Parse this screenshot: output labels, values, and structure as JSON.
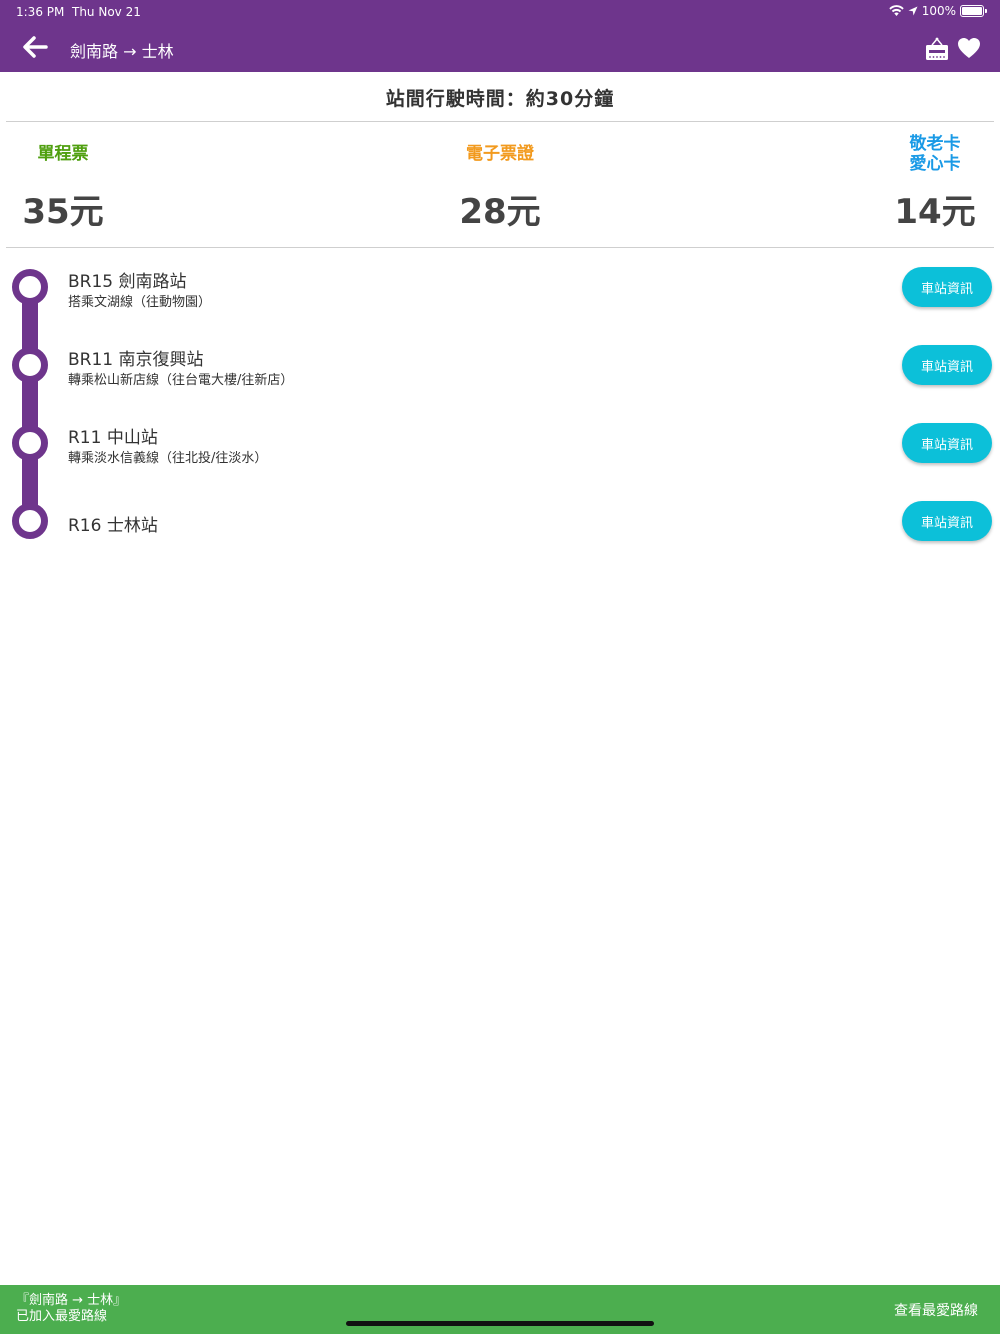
{
  "status_bar": {
    "time": "1:36 PM",
    "date": "Thu Nov 21",
    "battery": "100%",
    "battery_level": 1.0
  },
  "nav": {
    "title": "劍南路 → 士林",
    "back_icon": "back-arrow-icon",
    "hotel_icon": "hotel-sign-icon",
    "favorite_icon": "heart-icon"
  },
  "travel_time": "站間行駛時間：約30分鐘",
  "fares": [
    {
      "label": "單程票",
      "value": "35元",
      "color": "#4f9f0f"
    },
    {
      "label": "電子票證",
      "value": "28元",
      "color": "#f29a1e"
    },
    {
      "label_line1": "敬老卡",
      "label_line2": "愛心卡",
      "value": "14元",
      "color": "#1a9ae6"
    }
  ],
  "stations": [
    {
      "name": "BR15 劍南路站",
      "note": "搭乘文湖線（往動物園）",
      "button": "車站資訊"
    },
    {
      "name": "BR11 南京復興站",
      "note": "轉乘松山新店線（往台電大樓/往新店）",
      "button": "車站資訊"
    },
    {
      "name": "R11 中山站",
      "note": "轉乘淡水信義線（往北投/往淡水）",
      "button": "車站資訊"
    },
    {
      "name": "R16 士林站",
      "note": "",
      "button": "車站資訊"
    }
  ],
  "line_color": "#6e358c",
  "snackbar": {
    "line1": "『劍南路 → 士林』",
    "line2": "已加入最愛路線",
    "action": "查看最愛路線"
  }
}
